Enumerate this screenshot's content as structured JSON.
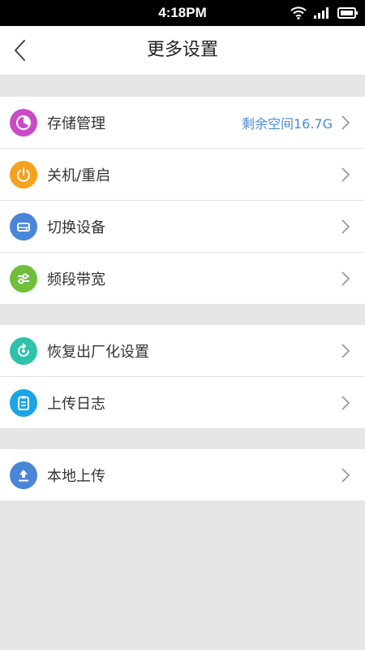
{
  "status_bar": {
    "time": "4:18PM"
  },
  "header": {
    "title": "更多设置"
  },
  "groups": [
    {
      "items": [
        {
          "label": "存储管理",
          "value": "剩余空间16.7G",
          "icon": "storage-icon",
          "color": "#c94bc5"
        },
        {
          "label": "关机/重启",
          "icon": "power-icon",
          "color": "#f3a21e"
        },
        {
          "label": "切换设备",
          "icon": "device-switch-icon",
          "color": "#4a86d8"
        },
        {
          "label": "频段带宽",
          "icon": "bandwidth-sliders-icon",
          "color": "#6fbf3b"
        }
      ]
    },
    {
      "items": [
        {
          "label": "恢复出厂化设置",
          "icon": "factory-reset-icon",
          "color": "#2ec2ad"
        },
        {
          "label": "上传日志",
          "icon": "upload-log-icon",
          "color": "#1aa6e6"
        }
      ]
    },
    {
      "items": [
        {
          "label": "本地上传",
          "icon": "local-upload-icon",
          "color": "#4a86d8"
        }
      ]
    }
  ]
}
